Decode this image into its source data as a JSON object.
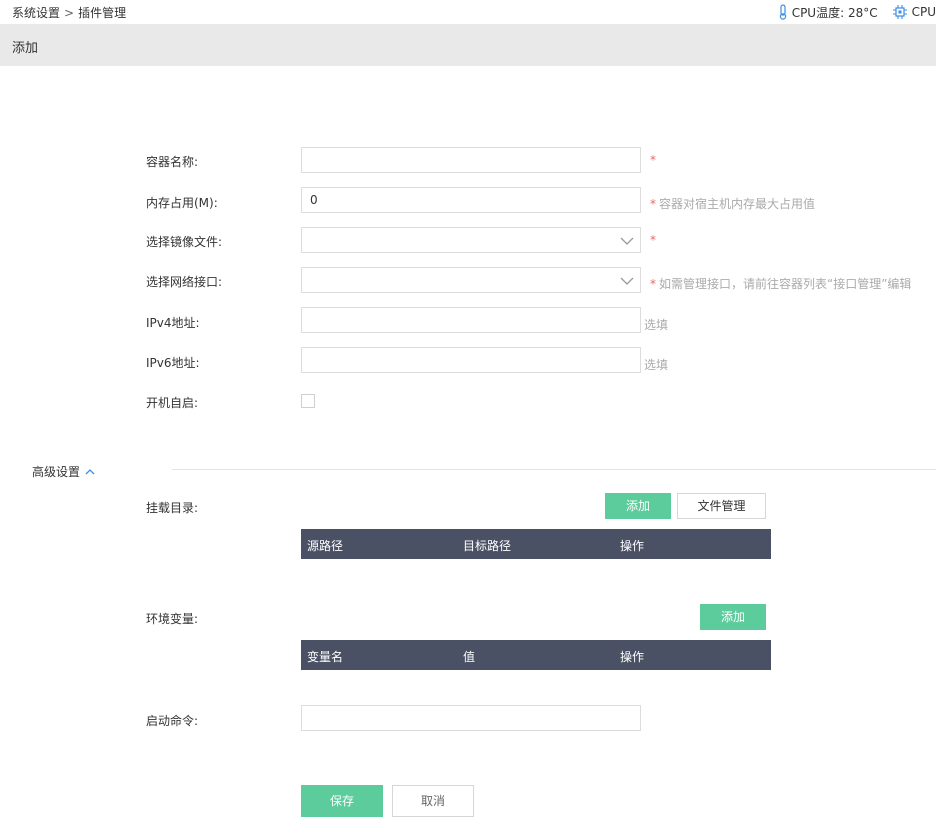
{
  "breadcrumb": {
    "parent": "系统设置",
    "separator": ">",
    "current": "插件管理"
  },
  "status": {
    "cpu_temp_label": "CPU温度: 28°C",
    "cpu_label": "CPU"
  },
  "page_title": "添加",
  "form": {
    "name": {
      "label": "容器名称:",
      "value": "",
      "required_mark": "*"
    },
    "memory": {
      "label": "内存占用(M):",
      "value": "0",
      "hint": "容器对宿主机内存最大占用值",
      "required_mark": "*"
    },
    "image": {
      "label": "选择镜像文件:",
      "value": "",
      "required_mark": "*"
    },
    "network": {
      "label": "选择网络接口:",
      "value": "",
      "hint": "如需管理接口，请前往容器列表“接口管理”编辑",
      "required_mark": "*"
    },
    "ipv4": {
      "label": "IPv4地址:",
      "value": "",
      "hint": "选填"
    },
    "ipv6": {
      "label": "IPv6地址:",
      "value": "",
      "hint": "选填"
    },
    "autostart": {
      "label": "开机自启:",
      "checked": false
    }
  },
  "advanced": {
    "label": "高级设置",
    "mount": {
      "label": "挂载目录:",
      "add_button": "添加",
      "file_button": "文件管理",
      "columns": [
        "源路径",
        "目标路径",
        "操作"
      ]
    },
    "env": {
      "label": "环境变量:",
      "add_button": "添加",
      "columns": [
        "变量名",
        "值",
        "操作"
      ]
    },
    "command": {
      "label": "启动命令:",
      "value": ""
    }
  },
  "actions": {
    "save": "保存",
    "cancel": "取消"
  },
  "colors": {
    "accent": "#5ccc9c",
    "table_header": "#4b5164",
    "required": "#e86a6a",
    "hint": "#aaaaaa"
  }
}
